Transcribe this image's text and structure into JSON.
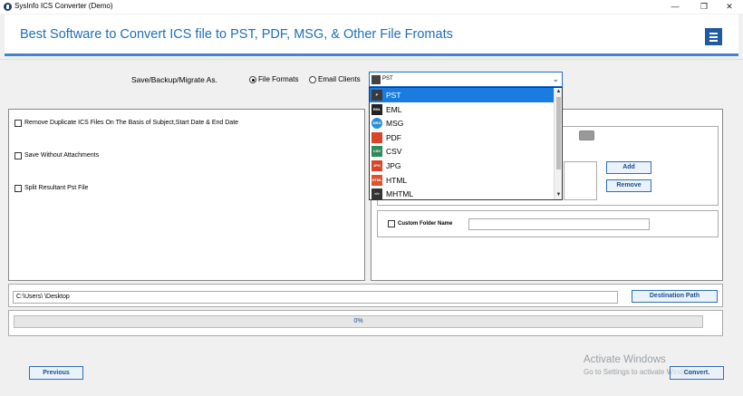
{
  "window": {
    "title": "SysInfo ICS Converter (Demo)",
    "controls": {
      "minimize": "—",
      "maximize": "❐",
      "close": "✕"
    }
  },
  "header": {
    "title": "Best Software to Convert ICS file to PST, PDF, MSG, & Other File Fromats",
    "accent_color": "#1e6fb8"
  },
  "save_options": {
    "label": "Save/Backup/Migrate As.",
    "radio_file_formats": "File Formats",
    "radio_email_clients": "Email Clients",
    "selected_radio": "File Formats",
    "selected_format": "PST"
  },
  "dropdown": {
    "items": [
      {
        "label": "PST",
        "icon": "pst-icon",
        "color": "#3a3a3a",
        "tag": "P"
      },
      {
        "label": "EML",
        "icon": "eml-icon",
        "color": "#222222",
        "tag": "EML"
      },
      {
        "label": "MSG",
        "icon": "msg-icon",
        "color": "#2a8fd6",
        "tag": "MSG"
      },
      {
        "label": "PDF",
        "icon": "pdf-icon",
        "color": "#d9442b",
        "tag": ""
      },
      {
        "label": "CSV",
        "icon": "csv-icon",
        "color": "#2e8b57",
        "tag": "CSV"
      },
      {
        "label": "JPG",
        "icon": "jpg-icon",
        "color": "#d9442b",
        "tag": "JPG"
      },
      {
        "label": "HTML",
        "icon": "html-icon",
        "color": "#e0522b",
        "tag": "HTML"
      },
      {
        "label": "MHTML",
        "icon": "mhtml-icon",
        "color": "#333333",
        "tag": "</>"
      }
    ],
    "selected_index": 0
  },
  "options": {
    "remove_duplicates": "Remove Duplicate ICS Files On The Basis of Subject,Start Date & End Date",
    "save_without_attachments": "Save Without Attachments",
    "split_pst": "Split Resultant Pst File"
  },
  "right_panel": {
    "add_button": "Add",
    "remove_button": "Remove",
    "custom_folder_label": "Custom Folder Name",
    "custom_folder_value": ""
  },
  "destination": {
    "path_value": "C:\\Users\\        \\Desktop",
    "button": "Destination Path"
  },
  "progress": {
    "percent_text": "0%",
    "value": 0
  },
  "footer": {
    "previous_button": "Previous",
    "convert_button": "Convert.",
    "watermark_line1": "Activate Windows",
    "watermark_line2": "Go to Settings to activate Windows."
  }
}
